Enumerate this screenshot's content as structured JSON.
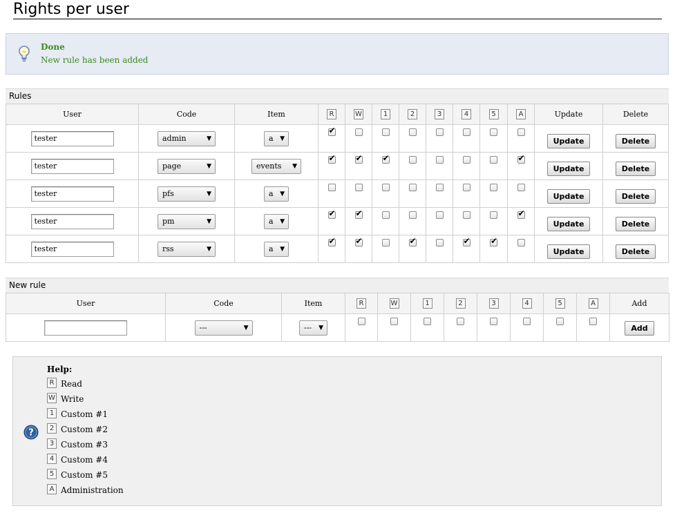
{
  "page": {
    "title": "Rights per user"
  },
  "notice": {
    "title": "Done",
    "message": "New rule has been added"
  },
  "rules": {
    "heading": "Rules",
    "columns": {
      "user": "User",
      "code": "Code",
      "item": "Item",
      "update": "Update",
      "delete": "Delete"
    },
    "perm_keys": [
      "R",
      "W",
      "1",
      "2",
      "3",
      "4",
      "5",
      "A"
    ],
    "rows": [
      {
        "user": "tester",
        "code": "admin",
        "item": "a",
        "perms": [
          true,
          false,
          false,
          false,
          false,
          false,
          false,
          false
        ]
      },
      {
        "user": "tester",
        "code": "page",
        "item": "events",
        "perms": [
          true,
          true,
          true,
          false,
          false,
          false,
          false,
          true
        ]
      },
      {
        "user": "tester",
        "code": "pfs",
        "item": "a",
        "perms": [
          false,
          false,
          false,
          false,
          false,
          false,
          false,
          false
        ]
      },
      {
        "user": "tester",
        "code": "pm",
        "item": "a",
        "perms": [
          true,
          true,
          false,
          false,
          false,
          false,
          false,
          true
        ]
      },
      {
        "user": "tester",
        "code": "rss",
        "item": "a",
        "perms": [
          true,
          true,
          false,
          true,
          false,
          true,
          true,
          false
        ]
      }
    ],
    "update_label": "Update",
    "delete_label": "Delete"
  },
  "new_rule": {
    "heading": "New rule",
    "columns": {
      "user": "User",
      "code": "Code",
      "item": "Item",
      "add": "Add"
    },
    "user_value": "",
    "code_value": "---",
    "item_value": "---",
    "perms": [
      false,
      false,
      false,
      false,
      false,
      false,
      false,
      false
    ],
    "add_label": "Add"
  },
  "help": {
    "title": "Help:",
    "items": [
      {
        "key": "R",
        "label": "Read"
      },
      {
        "key": "W",
        "label": "Write"
      },
      {
        "key": "1",
        "label": "Custom #1"
      },
      {
        "key": "2",
        "label": "Custom #2"
      },
      {
        "key": "3",
        "label": "Custom #3"
      },
      {
        "key": "4",
        "label": "Custom #4"
      },
      {
        "key": "5",
        "label": "Custom #5"
      },
      {
        "key": "A",
        "label": "Administration"
      }
    ]
  },
  "icons": {
    "notice": "lightbulb-icon",
    "help": "question-mark-icon"
  },
  "colors": {
    "success_text": "#3d8a1e",
    "notice_bg": "#e6ebf4",
    "help_bg": "#f0f0f0"
  }
}
